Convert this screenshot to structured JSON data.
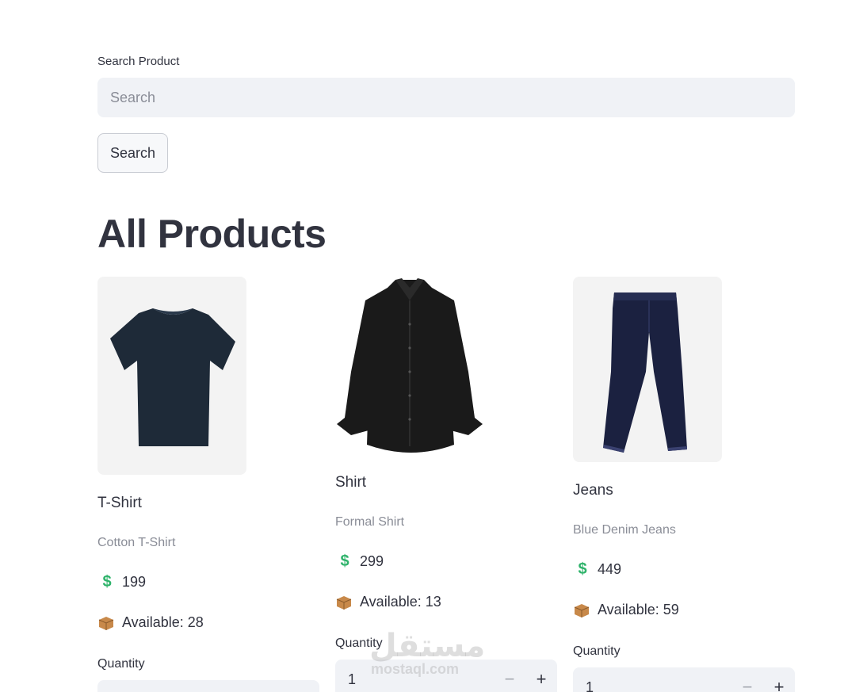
{
  "search": {
    "label": "Search Product",
    "placeholder": "Search",
    "value": "",
    "button_label": "Search"
  },
  "page_title": "All Products",
  "products": [
    {
      "name": "T-Shirt",
      "description": "Cotton T-Shirt",
      "price": "199",
      "available": "Available: 28",
      "quantity_label": "Quantity",
      "quantity": "",
      "image_icon": "tshirt-image",
      "image_color": "#1e2a38"
    },
    {
      "name": "Shirt",
      "description": "Formal Shirt",
      "price": "299",
      "available": "Available: 13",
      "quantity_label": "Quantity",
      "quantity": "1",
      "image_icon": "shirt-image",
      "image_color": "#1a1a1a"
    },
    {
      "name": "Jeans",
      "description": "Blue Denim Jeans",
      "price": "449",
      "available": "Available: 59",
      "quantity_label": "Quantity",
      "quantity": "1",
      "image_icon": "jeans-image",
      "image_color": "#1b2140"
    }
  ],
  "icons": {
    "price": "$",
    "stock": "package-icon",
    "decrement": "−",
    "increment": "+"
  },
  "watermark": {
    "logo": "مستقل",
    "text": "mostaql.com"
  },
  "colors": {
    "dollar": "#2fb36b",
    "input_bg": "#f0f2f6",
    "text": "#31333f",
    "muted": "#8a8d97"
  }
}
